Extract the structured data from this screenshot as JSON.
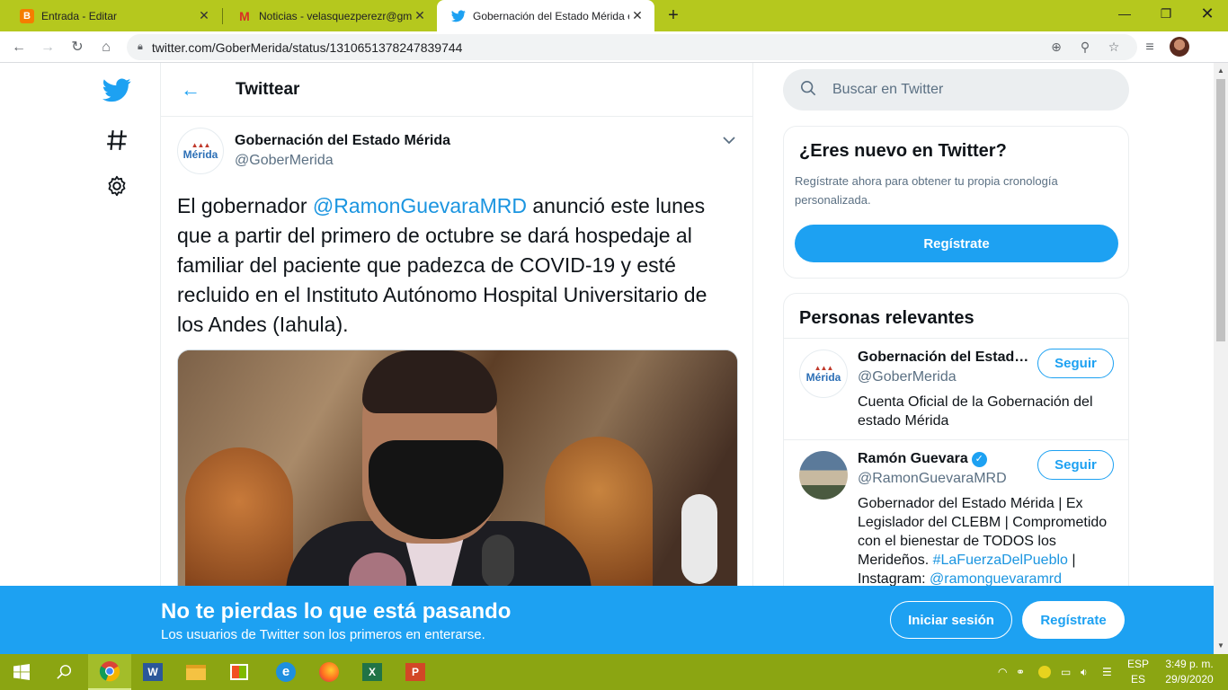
{
  "browser": {
    "tabs": [
      {
        "title": "Entrada - Editar",
        "favicon": "blogger-icon",
        "active": false
      },
      {
        "title": "Noticias - velasquezperezr@gma",
        "favicon": "gmail-icon",
        "active": false
      },
      {
        "title": "Gobernación del Estado Mérida e",
        "favicon": "twitter-icon",
        "active": true
      }
    ],
    "url": "twitter.com/GoberMerida/status/1310651378247839744"
  },
  "header": {
    "title": "Twittear"
  },
  "tweet": {
    "author_name": "Gobernación del Estado Mérida",
    "author_handle": "@GoberMerida",
    "logo_text": "Mérida",
    "text_before": "El gobernador ",
    "mention": "@RamonGuevaraMRD",
    "text_after": " anunció este lunes que a partir del primero de octubre se dará hospedaje al familiar del paciente que padezca de COVID-19 y esté recluido en el Instituto Autónomo Hospital Universitario de los Andes (Iahula)."
  },
  "search": {
    "placeholder": "Buscar en Twitter"
  },
  "signup_card": {
    "title": "¿Eres nuevo en Twitter?",
    "subtitle": "Regístrate ahora para obtener tu propia cronología personalizada.",
    "button": "Regístrate"
  },
  "relevant": {
    "title": "Personas relevantes",
    "people": [
      {
        "name": "Gobernación del Estado Mérida",
        "handle": "@GoberMerida",
        "bio": "Cuenta Oficial de la Gobernación del estado Mérida",
        "follow": "Seguir",
        "verified": false
      },
      {
        "name": "Ramón Guevara",
        "handle": "@RamonGuevaraMRD",
        "bio": "Gobernador del Estado Mérida | Ex Legislador del CLEBM | Comprometido con el bienestar de TODOS los Merideños. ",
        "hashtag": "#LaFuerzaDelPueblo",
        "bio_sep": " | Instagram: ",
        "instagram": "@ramonguevaramrd",
        "follow": "Seguir",
        "verified": true
      }
    ]
  },
  "banner": {
    "title": "No te pierdas lo que está pasando",
    "subtitle": "Los usuarios de Twitter son los primeros en enterarse.",
    "login": "Iniciar sesión",
    "signup": "Regístrate"
  },
  "taskbar": {
    "lang_top": "ESP",
    "lang_bottom": "ES",
    "time": "3:49 p. m.",
    "date": "29/9/2020"
  },
  "colors": {
    "twitter_blue": "#1da1f2",
    "tab_strip": "#b5c81e",
    "taskbar": "#8ba512"
  }
}
